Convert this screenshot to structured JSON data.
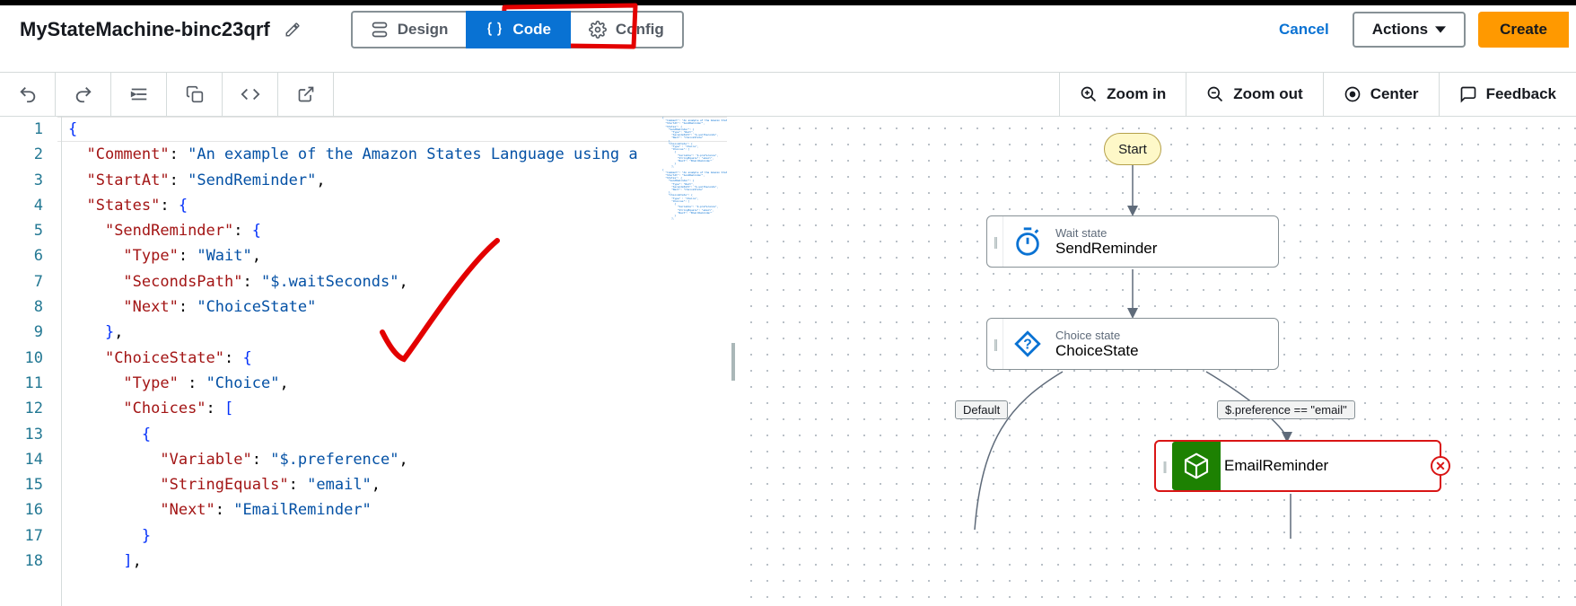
{
  "header": {
    "title": "MyStateMachine-binc23qrf",
    "tabs": {
      "design": "Design",
      "code": "Code",
      "config": "Config"
    },
    "cancel": "Cancel",
    "actions": "Actions",
    "create": "Create"
  },
  "toolbar": {
    "zoom_in": "Zoom in",
    "zoom_out": "Zoom out",
    "center": "Center",
    "feedback": "Feedback"
  },
  "code": {
    "lines": [
      [
        [
          "brace",
          "{"
        ]
      ],
      [
        [
          "pad",
          "  "
        ],
        [
          "key",
          "\"Comment\""
        ],
        [
          "punc",
          ": "
        ],
        [
          "str",
          "\"An example of the Amazon States Language using a "
        ]
      ],
      [
        [
          "pad",
          "  "
        ],
        [
          "key",
          "\"StartAt\""
        ],
        [
          "punc",
          ": "
        ],
        [
          "str",
          "\"SendReminder\""
        ],
        [
          "punc",
          ","
        ]
      ],
      [
        [
          "pad",
          "  "
        ],
        [
          "key",
          "\"States\""
        ],
        [
          "punc",
          ": "
        ],
        [
          "brace",
          "{"
        ]
      ],
      [
        [
          "pad",
          "    "
        ],
        [
          "key",
          "\"SendReminder\""
        ],
        [
          "punc",
          ": "
        ],
        [
          "brace",
          "{"
        ]
      ],
      [
        [
          "pad",
          "      "
        ],
        [
          "key",
          "\"Type\""
        ],
        [
          "punc",
          ": "
        ],
        [
          "str",
          "\"Wait\""
        ],
        [
          "punc",
          ","
        ]
      ],
      [
        [
          "pad",
          "      "
        ],
        [
          "key",
          "\"SecondsPath\""
        ],
        [
          "punc",
          ": "
        ],
        [
          "str",
          "\"$.waitSeconds\""
        ],
        [
          "punc",
          ","
        ]
      ],
      [
        [
          "pad",
          "      "
        ],
        [
          "key",
          "\"Next\""
        ],
        [
          "punc",
          ": "
        ],
        [
          "str",
          "\"ChoiceState\""
        ]
      ],
      [
        [
          "pad",
          "    "
        ],
        [
          "brace",
          "}"
        ],
        [
          "punc",
          ","
        ]
      ],
      [
        [
          "pad",
          "    "
        ],
        [
          "key",
          "\"ChoiceState\""
        ],
        [
          "punc",
          ": "
        ],
        [
          "brace",
          "{"
        ]
      ],
      [
        [
          "pad",
          "      "
        ],
        [
          "key",
          "\"Type\""
        ],
        [
          "punc",
          " : "
        ],
        [
          "str",
          "\"Choice\""
        ],
        [
          "punc",
          ","
        ]
      ],
      [
        [
          "pad",
          "      "
        ],
        [
          "key",
          "\"Choices\""
        ],
        [
          "punc",
          ": "
        ],
        [
          "brace",
          "["
        ]
      ],
      [
        [
          "pad",
          "        "
        ],
        [
          "brace",
          "{"
        ]
      ],
      [
        [
          "pad",
          "          "
        ],
        [
          "key",
          "\"Variable\""
        ],
        [
          "punc",
          ": "
        ],
        [
          "str",
          "\"$.preference\""
        ],
        [
          "punc",
          ","
        ]
      ],
      [
        [
          "pad",
          "          "
        ],
        [
          "key",
          "\"StringEquals\""
        ],
        [
          "punc",
          ": "
        ],
        [
          "str",
          "\"email\""
        ],
        [
          "punc",
          ","
        ]
      ],
      [
        [
          "pad",
          "          "
        ],
        [
          "key",
          "\"Next\""
        ],
        [
          "punc",
          ": "
        ],
        [
          "str",
          "\"EmailReminder\""
        ]
      ],
      [
        [
          "pad",
          "        "
        ],
        [
          "brace",
          "}"
        ]
      ],
      [
        [
          "pad",
          "      "
        ],
        [
          "brace",
          "]"
        ],
        [
          "punc",
          ","
        ]
      ]
    ]
  },
  "graph": {
    "start": "Start",
    "nodes": {
      "wait": {
        "subtitle": "Wait state",
        "title": "SendReminder"
      },
      "choice": {
        "subtitle": "Choice state",
        "title": "ChoiceState"
      },
      "email": {
        "title": "EmailReminder"
      }
    },
    "edges": {
      "default": "Default",
      "email_cond": "$.preference == \"email\""
    }
  }
}
